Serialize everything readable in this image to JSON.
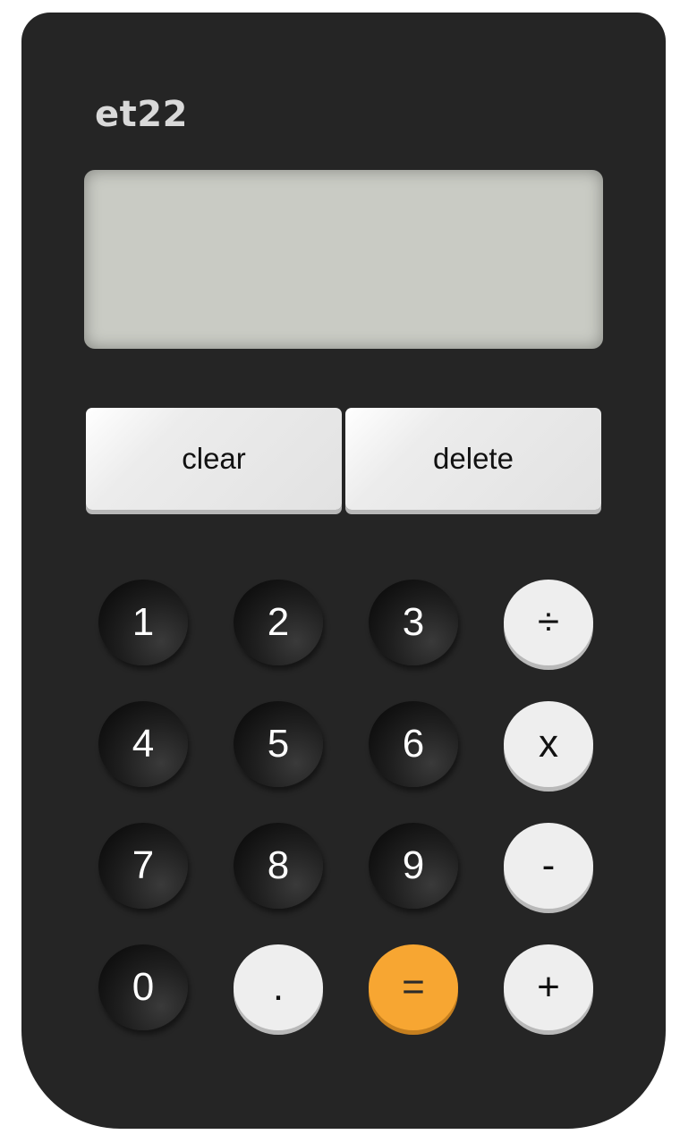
{
  "brand": "et22",
  "display": {
    "value": ""
  },
  "actions": {
    "clear": "clear",
    "delete": "delete"
  },
  "keys": {
    "one": "1",
    "two": "2",
    "three": "3",
    "divide": "÷",
    "four": "4",
    "five": "5",
    "six": "6",
    "multiply": "x",
    "seven": "7",
    "eight": "8",
    "nine": "9",
    "subtract": "-",
    "zero": "0",
    "decimal": ".",
    "equals": "=",
    "add": "+"
  },
  "colors": {
    "body": "#252525",
    "display": "#c9cbc4",
    "digit_key": "#1a1a1a",
    "operator_key": "#eeeeee",
    "equals_key": "#f7a632"
  }
}
